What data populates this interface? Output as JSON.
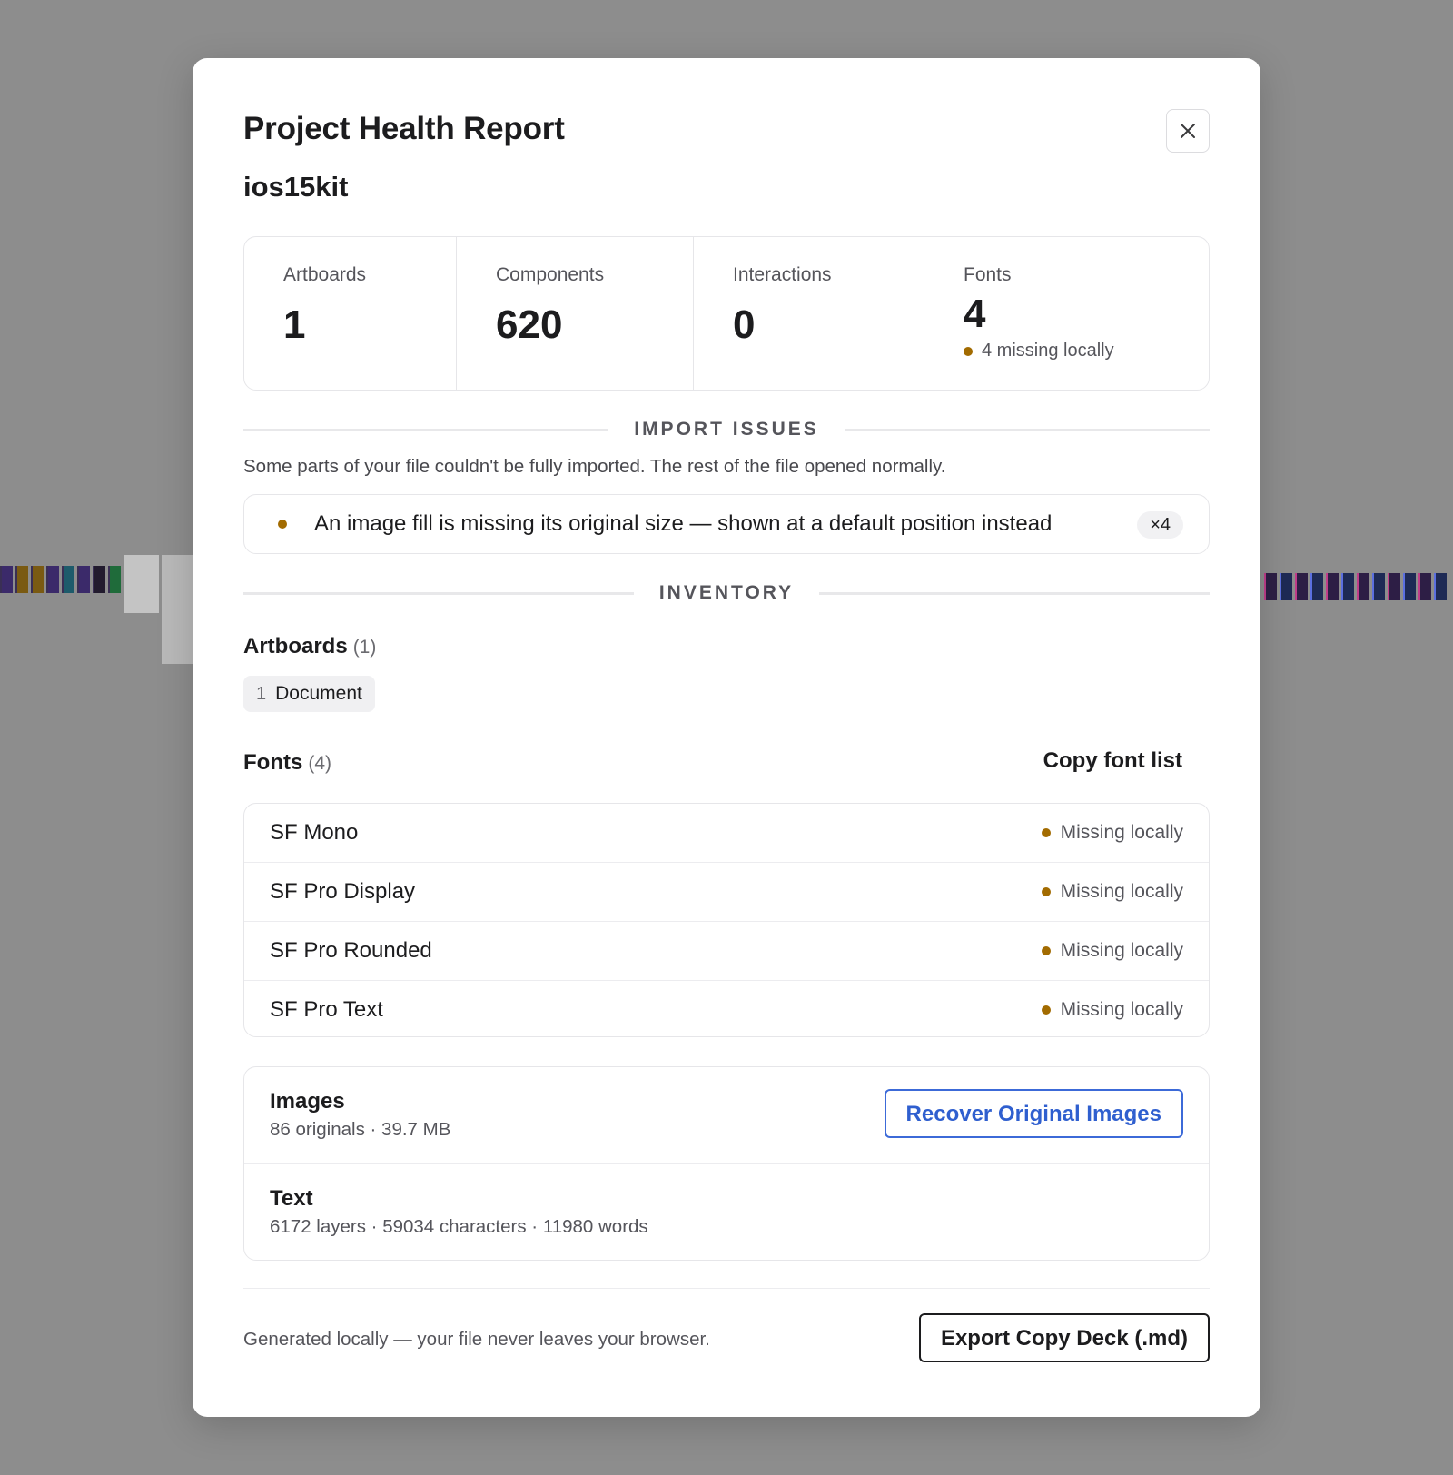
{
  "modal": {
    "title": "Project Health Report",
    "project_name": "ios15kit",
    "close_label": "close"
  },
  "stats": [
    {
      "label": "Artboards",
      "value": "1"
    },
    {
      "label": "Components",
      "value": "620"
    },
    {
      "label": "Interactions",
      "value": "0"
    },
    {
      "label": "Fonts",
      "value": "4",
      "note": "4 missing locally"
    }
  ],
  "import_issues": {
    "heading": "IMPORT ISSUES",
    "description": "Some parts of your file couldn't be fully imported. The rest of the file opened normally.",
    "items": [
      {
        "text": "An image fill is missing its original size — shown at a default position instead",
        "count": "×4"
      }
    ]
  },
  "inventory": {
    "heading": "INVENTORY",
    "artboards": {
      "title": "Artboards",
      "count": "(1)",
      "items": [
        {
          "index": "1",
          "name": "Document"
        }
      ]
    },
    "fonts": {
      "title": "Fonts",
      "count": "(4)",
      "copy_label": "Copy font list",
      "items": [
        {
          "name": "SF Mono",
          "status": "Missing locally"
        },
        {
          "name": "SF Pro Display",
          "status": "Missing locally"
        },
        {
          "name": "SF Pro Rounded",
          "status": "Missing locally"
        },
        {
          "name": "SF Pro Text",
          "status": "Missing locally"
        }
      ]
    },
    "images": {
      "title": "Images",
      "summary": "86 originals · 39.7 MB",
      "action_label": "Recover Original Images"
    },
    "text": {
      "title": "Text",
      "summary": "6172 layers · 59034 characters · 11980 words"
    }
  },
  "footer": {
    "note": "Generated locally — your file never leaves your browser.",
    "export_label": "Export Copy Deck (.md)"
  },
  "colors": {
    "warning_dot": "#a26b00",
    "accent_blue": "#2f5fcf",
    "overlay": "#8d8d8d"
  },
  "icons": {
    "close": "close-icon",
    "status": "warning-dot-icon"
  }
}
